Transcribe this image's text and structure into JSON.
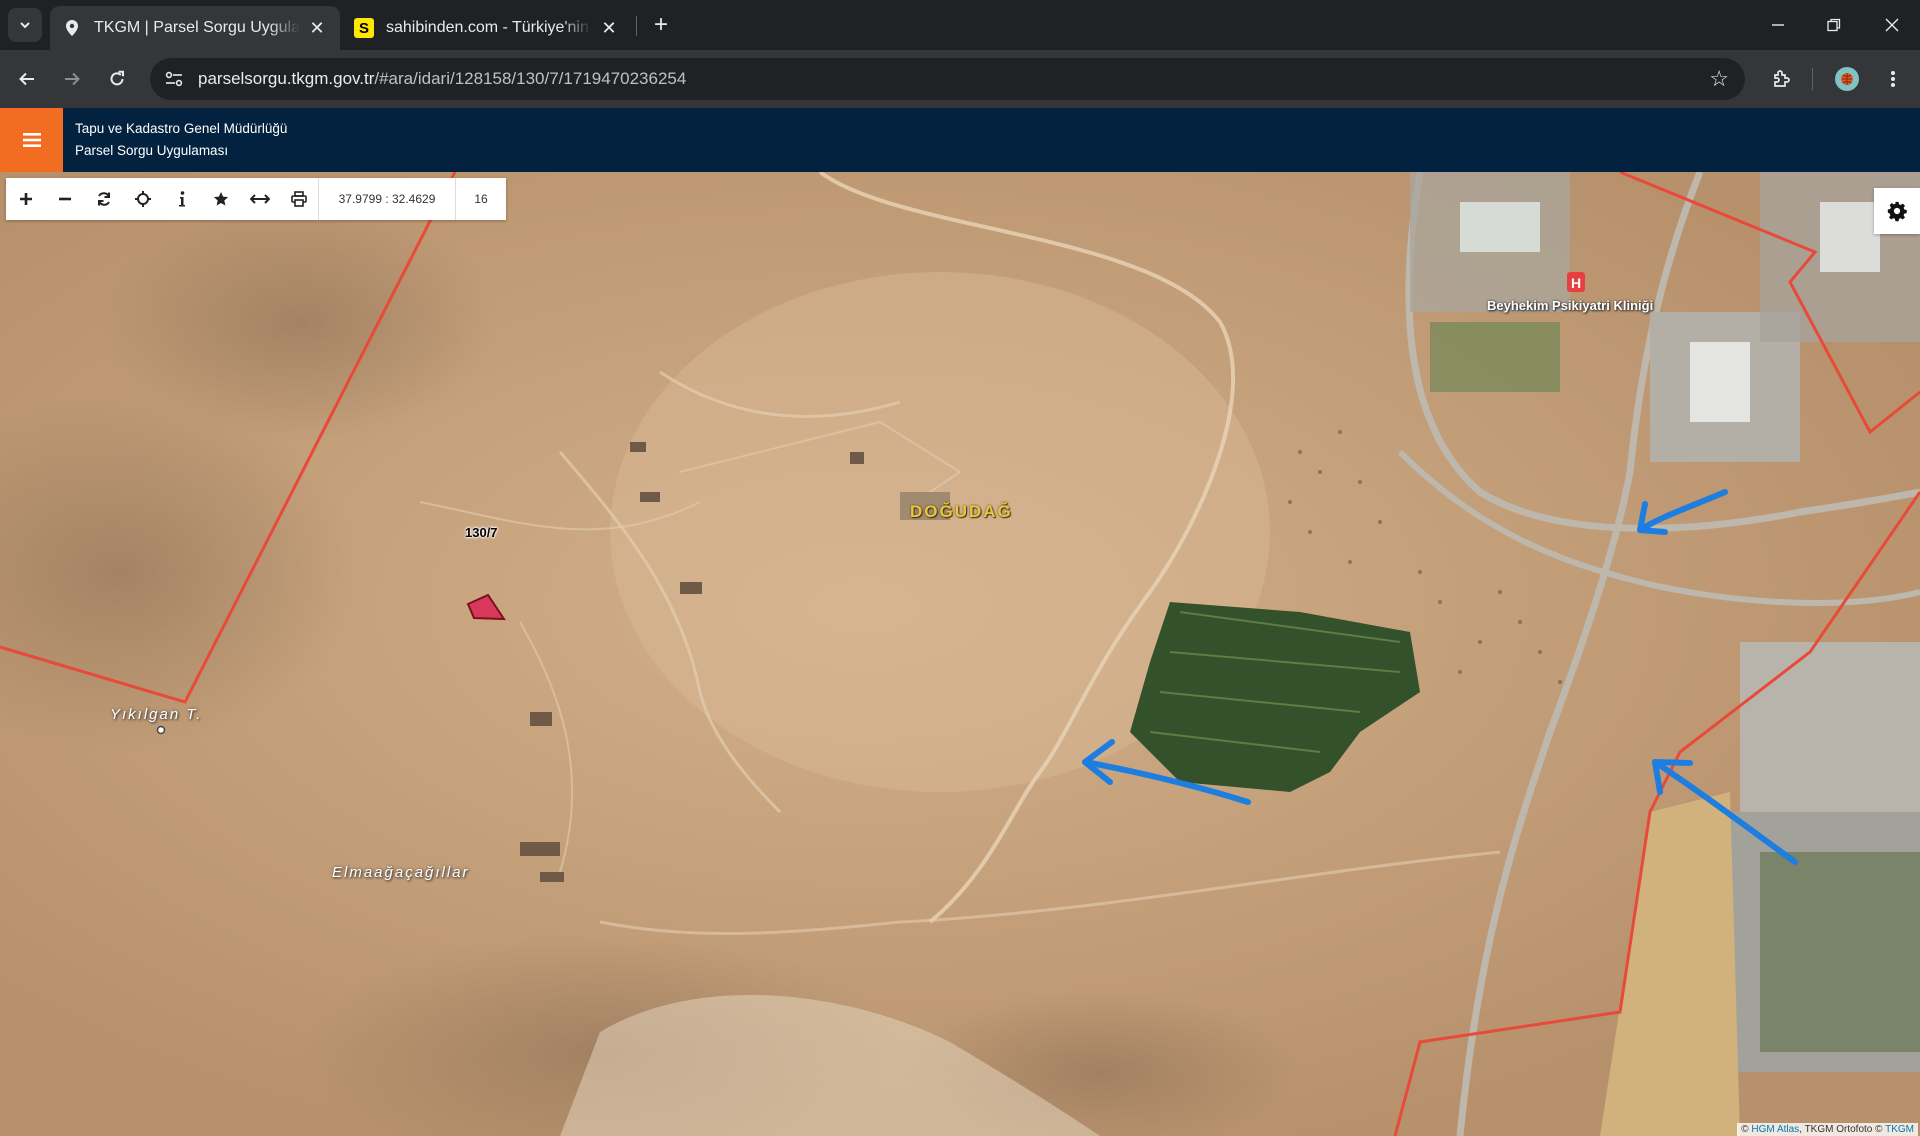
{
  "browser": {
    "tabs": [
      {
        "title": "TKGM | Parsel Sorgu Uygulaması",
        "icon": "map-pin-icon",
        "active": true
      },
      {
        "title": "sahibinden.com - Türkiye'nin Online Pazar Yeri",
        "icon": "sahibinden-s-icon",
        "active": false
      }
    ],
    "new_tab_symbol": "+",
    "url_host": "parselsorgu.tkgm.gov.tr",
    "url_path": "/#ara/idari/128158/130/7/1719470236254",
    "fav_letter": "S"
  },
  "app": {
    "org_name": "Tapu ve Kadastro Genel Müdürlüğü",
    "app_name": "Parsel Sorgu Uygulaması",
    "accent_color": "#f26d21",
    "header_color": "#03223f"
  },
  "map_toolbar": {
    "buttons": [
      "zoom-in-icon",
      "zoom-out-icon",
      "refresh-icon",
      "locate-icon",
      "info-icon",
      "star-icon",
      "measure-icon",
      "print-icon"
    ],
    "coordinates": "37.9799 : 32.4629",
    "zoom": "16"
  },
  "map": {
    "labels": {
      "hill": "DOĞUDAĞ",
      "hill_2": "Yıkılgan T.",
      "place": "Elmaağaçağıllar",
      "hospital": "Beyhekim Psikiyatri Kliniği"
    },
    "parcel": "130/7",
    "attribution": {
      "prefix": "© ",
      "source1": "HGM Atlas",
      "middle": ", TKGM Ortofoto © ",
      "source2": "TKGM"
    },
    "boundary_color": "#e84a3a",
    "arrow_color": "#1e7ee0"
  }
}
